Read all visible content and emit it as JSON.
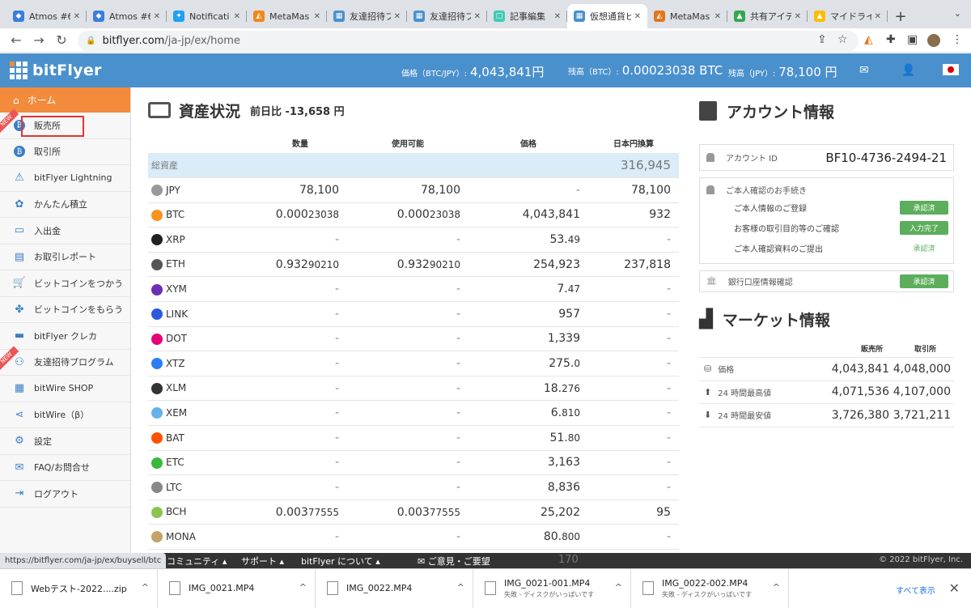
{
  "browser": {
    "tabs": [
      {
        "title": "Atmos #6",
        "color": "#3b7ddd",
        "glyph": "◆",
        "active": false
      },
      {
        "title": "Atmos #6",
        "color": "#3b7ddd",
        "glyph": "◆",
        "active": false
      },
      {
        "title": "Notificati",
        "color": "#1da1f2",
        "glyph": "✦",
        "active": false
      },
      {
        "title": "MetaMas",
        "color": "#f6851b",
        "glyph": "◭",
        "active": false
      },
      {
        "title": "友達招待プ",
        "color": "#4a90cd",
        "glyph": "▦",
        "active": false
      },
      {
        "title": "友達招待プ",
        "color": "#4a90cd",
        "glyph": "▦",
        "active": false
      },
      {
        "title": "記事編集",
        "color": "#41c9b4",
        "glyph": "□",
        "active": false
      },
      {
        "title": "仮想通貨ビ",
        "color": "#4a90cd",
        "glyph": "▦",
        "active": true
      },
      {
        "title": "MetaMas",
        "color": "#e2761b",
        "glyph": "◭",
        "active": false
      },
      {
        "title": "共有アイデ",
        "color": "#34a853",
        "glyph": "▲",
        "active": false
      },
      {
        "title": "マイドライ",
        "color": "#fbbc04",
        "glyph": "▲",
        "active": false
      }
    ],
    "url_host": "bitflyer.com",
    "url_path": "/ja-jp/ex/home"
  },
  "header": {
    "logo": "bitFlyer",
    "price_label": "価格（BTC/JPY）:",
    "price_value": "4,043,841円",
    "btc_label": "残高（BTC）:",
    "btc_value": "0.00023038 BTC",
    "jpy_label": "残高（JPY）:",
    "jpy_value": "78,100 円"
  },
  "sidebar": {
    "home": "ホーム",
    "items": [
      {
        "label": "販売所",
        "icon": "bitcoin-icon",
        "new": true
      },
      {
        "label": "取引所",
        "icon": "bitcoin-icon",
        "new": false
      },
      {
        "label": "bitFlyer Lightning",
        "icon": "lightning-icon",
        "new": false
      },
      {
        "label": "かんたん積立",
        "icon": "piggy-icon",
        "new": false
      },
      {
        "label": "入出金",
        "icon": "cash-icon",
        "new": false
      },
      {
        "label": "お取引レポート",
        "icon": "report-icon",
        "new": false
      },
      {
        "label": "ビットコインをつかう",
        "icon": "cart-icon",
        "new": false
      },
      {
        "label": "ビットコインをもらう",
        "icon": "gift-icon",
        "new": false
      },
      {
        "label": "bitFlyer クレカ",
        "icon": "card-icon",
        "new": false
      },
      {
        "label": "友達招待プログラム",
        "icon": "friends-icon",
        "new": true
      },
      {
        "label": "bitWire SHOP",
        "icon": "shop-icon",
        "new": false
      },
      {
        "label": "bitWire（β）",
        "icon": "share-icon",
        "new": false
      },
      {
        "label": "設定",
        "icon": "gear-icon",
        "new": false
      },
      {
        "label": "FAQ/お問合せ",
        "icon": "mail-icon",
        "new": false
      },
      {
        "label": "ログアウト",
        "icon": "logout-icon",
        "new": false
      }
    ],
    "new_badge": "NEW"
  },
  "assets": {
    "title": "資産状況",
    "diff": "前日比 -13,658 円",
    "columns": [
      "数量",
      "使用可能",
      "価格",
      "日本円換算"
    ],
    "total_label": "総資産",
    "total_value": "316,945",
    "rows": [
      {
        "coin": "JPY",
        "color": "#999999",
        "qty": "78,100",
        "qty_s": "",
        "avail": "78,100",
        "avail_s": "",
        "price": "-",
        "price_s": "",
        "jpy": "78,100"
      },
      {
        "coin": "BTC",
        "color": "#f7931a",
        "qty": "0.000",
        "qty_s": "23038",
        "avail": "0.000",
        "avail_s": "23038",
        "price": "4,043,841",
        "price_s": "",
        "jpy": "932"
      },
      {
        "coin": "XRP",
        "color": "#222222",
        "qty": "-",
        "qty_s": "",
        "avail": "-",
        "avail_s": "",
        "price": "53.",
        "price_s": "49",
        "jpy": "-"
      },
      {
        "coin": "ETH",
        "color": "#555555",
        "qty": "0.932",
        "qty_s": "90210",
        "avail": "0.932",
        "avail_s": "90210",
        "price": "254,923",
        "price_s": "",
        "jpy": "237,818"
      },
      {
        "coin": "XYM",
        "color": "#6b2fb3",
        "qty": "-",
        "qty_s": "",
        "avail": "-",
        "avail_s": "",
        "price": "7.",
        "price_s": "47",
        "jpy": "-"
      },
      {
        "coin": "LINK",
        "color": "#2a5ada",
        "qty": "-",
        "qty_s": "",
        "avail": "-",
        "avail_s": "",
        "price": "957",
        "price_s": "",
        "jpy": "-"
      },
      {
        "coin": "DOT",
        "color": "#e6007a",
        "qty": "-",
        "qty_s": "",
        "avail": "-",
        "avail_s": "",
        "price": "1,339",
        "price_s": "",
        "jpy": "-"
      },
      {
        "coin": "XTZ",
        "color": "#2c7df7",
        "qty": "-",
        "qty_s": "",
        "avail": "-",
        "avail_s": "",
        "price": "275.",
        "price_s": "0",
        "jpy": "-"
      },
      {
        "coin": "XLM",
        "color": "#333333",
        "qty": "-",
        "qty_s": "",
        "avail": "-",
        "avail_s": "",
        "price": "18.",
        "price_s": "276",
        "jpy": "-"
      },
      {
        "coin": "XEM",
        "color": "#67b2e8",
        "qty": "-",
        "qty_s": "",
        "avail": "-",
        "avail_s": "",
        "price": "6.",
        "price_s": "810",
        "jpy": "-"
      },
      {
        "coin": "BAT",
        "color": "#ff5000",
        "qty": "-",
        "qty_s": "",
        "avail": "-",
        "avail_s": "",
        "price": "51.",
        "price_s": "80",
        "jpy": "-"
      },
      {
        "coin": "ETC",
        "color": "#3ab83a",
        "qty": "-",
        "qty_s": "",
        "avail": "-",
        "avail_s": "",
        "price": "3,163",
        "price_s": "",
        "jpy": "-"
      },
      {
        "coin": "LTC",
        "color": "#888888",
        "qty": "-",
        "qty_s": "",
        "avail": "-",
        "avail_s": "",
        "price": "8,836",
        "price_s": "",
        "jpy": "-"
      },
      {
        "coin": "BCH",
        "color": "#8dc351",
        "qty": "0.003",
        "qty_s": "77555",
        "avail": "0.003",
        "avail_s": "77555",
        "price": "25,202",
        "price_s": "",
        "jpy": "95"
      },
      {
        "coin": "MONA",
        "color": "#c4a26a",
        "qty": "-",
        "qty_s": "",
        "avail": "-",
        "avail_s": "",
        "price": "80.",
        "price_s": "800",
        "jpy": "-"
      }
    ]
  },
  "account": {
    "title": "アカウント情報",
    "id_label": "アカウント ID",
    "id_value": "BF10-4736-2494-21",
    "kyc_title": "ご本人確認のお手続き",
    "kyc_rows": [
      {
        "label": "ご本人情報のご登録",
        "status": "承認済",
        "style": "badge"
      },
      {
        "label": "お客様の取引目的等のご確認",
        "status": "入力完了",
        "style": "badge"
      },
      {
        "label": "ご本人確認資料のご提出",
        "status": "承認済",
        "style": "text"
      }
    ],
    "bank_label": "銀行口座情報確認",
    "bank_status": "承認済"
  },
  "market": {
    "title": "マーケット情報",
    "col1": "販売所",
    "col2": "取引所",
    "rows": [
      {
        "label": "価格",
        "v1": "4,043,841",
        "v2": "4,048,000"
      },
      {
        "label": "24 時間最高値",
        "v1": "4,071,536",
        "v2": "4,107,000"
      },
      {
        "label": "24 時間最安値",
        "v1": "3,726,380",
        "v2": "3,721,211"
      }
    ]
  },
  "footer": {
    "status_url": "https://bitflyer.com/ja-jp/ex/buysell/btc",
    "links": [
      "コミュニティ ▴",
      "サポート ▴",
      "bitFlyer について ▴",
      "✉ ご意見・ご要望"
    ],
    "partial": "170",
    "copyright": "© 2022 bitFlyer, Inc."
  },
  "downloads": {
    "items": [
      {
        "name": "Webテスト-2022....zip",
        "sub": ""
      },
      {
        "name": "IMG_0021.MP4",
        "sub": ""
      },
      {
        "name": "IMG_0022.MP4",
        "sub": ""
      },
      {
        "name": "IMG_0021-001.MP4",
        "sub": "失敗 - ディスクがいっぱいです"
      },
      {
        "name": "IMG_0022-002.MP4",
        "sub": "失敗 - ディスクがいっぱいです"
      }
    ],
    "show_all": "すべて表示"
  }
}
